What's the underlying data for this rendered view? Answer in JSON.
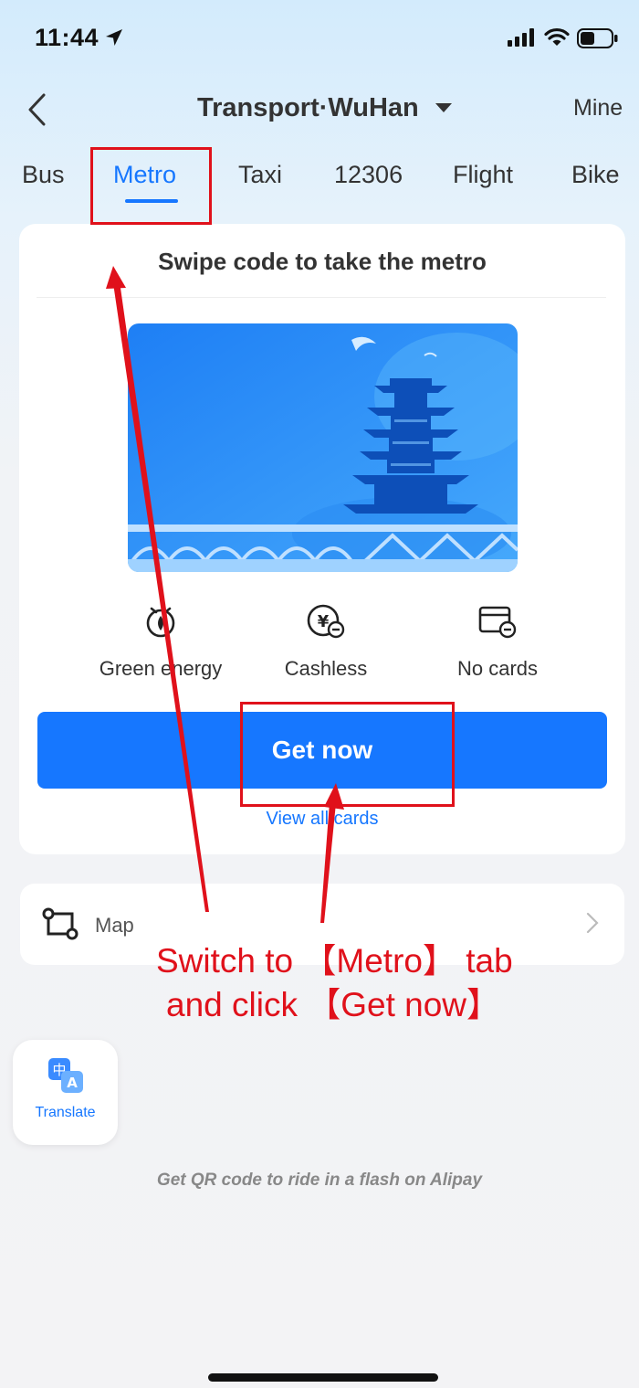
{
  "status_bar": {
    "time": "11:44"
  },
  "nav": {
    "title": "Transport·WuHan",
    "mine": "Mine"
  },
  "tabs": [
    {
      "label": "Bus",
      "active": false
    },
    {
      "label": "Metro",
      "active": true
    },
    {
      "label": "Taxi",
      "active": false
    },
    {
      "label": "12306",
      "active": false
    },
    {
      "label": "Flight",
      "active": false
    },
    {
      "label": "Bike",
      "active": false
    }
  ],
  "card": {
    "title": "Swipe code to take the metro",
    "features": [
      {
        "icon": "leaf-icon",
        "label": "Green energy"
      },
      {
        "icon": "yuan-coin-icon",
        "label": "Cashless"
      },
      {
        "icon": "card-icon",
        "label": "No cards"
      }
    ],
    "get_now_label": "Get now",
    "view_all_label": "View all cards"
  },
  "map": {
    "label": "Map"
  },
  "translate": {
    "label": "Translate"
  },
  "footer": "Get QR code to ride in a flash on Alipay",
  "annotation": {
    "line1": "Switch to 【Metro】 tab",
    "line2": "and click 【Get now】"
  },
  "colors": {
    "accent": "#1677ff",
    "annotation": "#e0111b",
    "background_top": "#d3ebfc",
    "background": "#f3f3f5"
  }
}
